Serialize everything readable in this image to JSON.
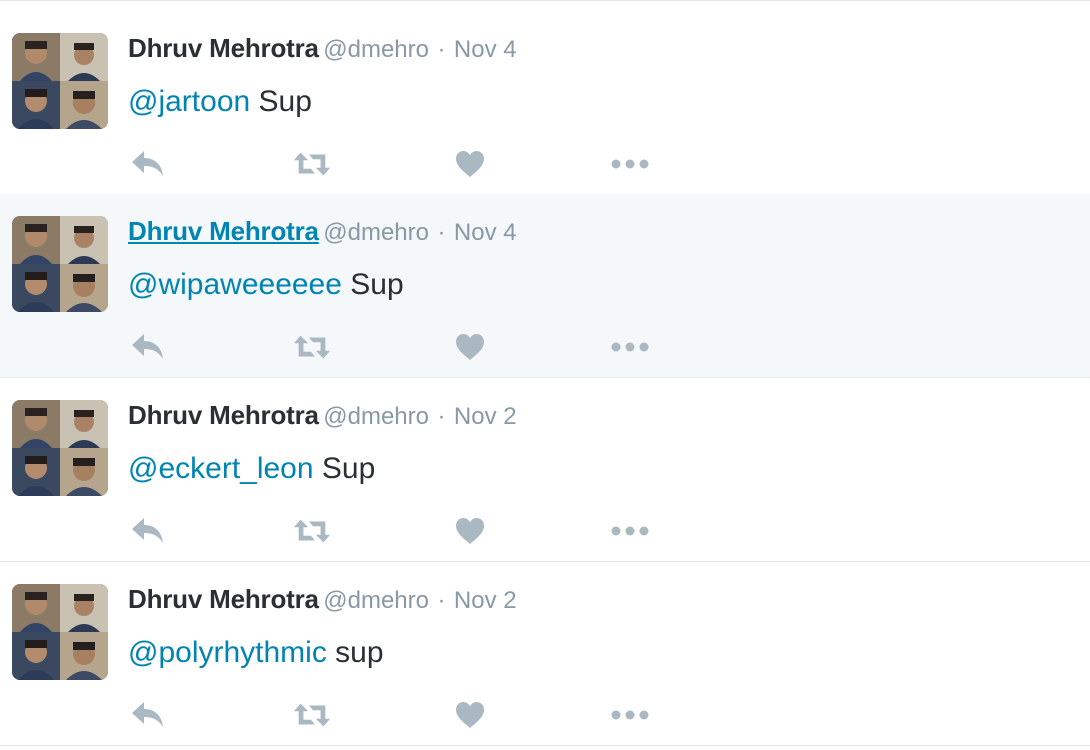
{
  "icon_color": "#aab8c2",
  "tweets": [
    {
      "fullname": "Dhruv Mehrotra",
      "username": "@dmehro",
      "separator": "·",
      "time": "Nov 4",
      "mention": "@jartoon",
      "body": " Sup",
      "hovered": false
    },
    {
      "fullname": "Dhruv Mehrotra",
      "username": "@dmehro",
      "separator": "·",
      "time": "Nov 4",
      "mention": "@wipaweeeeee",
      "body": " Sup",
      "hovered": true
    },
    {
      "fullname": "Dhruv Mehrotra",
      "username": "@dmehro",
      "separator": "·",
      "time": "Nov 2",
      "mention": "@eckert_leon",
      "body": " Sup",
      "hovered": false
    },
    {
      "fullname": "Dhruv Mehrotra",
      "username": "@dmehro",
      "separator": "·",
      "time": "Nov 2",
      "mention": "@polyrhythmic",
      "body": " sup",
      "hovered": false
    }
  ],
  "actions": [
    "reply-icon",
    "retweet-icon",
    "like-icon",
    "more-icon"
  ]
}
